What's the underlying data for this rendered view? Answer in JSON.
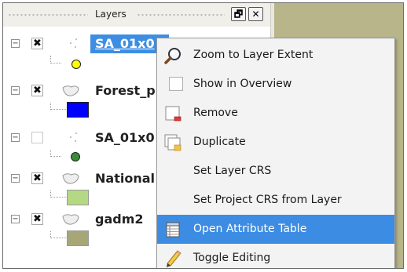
{
  "panel": {
    "title": "Layers",
    "float_button_glyph": "🗗",
    "close_button_glyph": "✕"
  },
  "layers": [
    {
      "name": "SA_01x0",
      "checked": true,
      "geometry": "point",
      "legend": "yellow-circle",
      "legend_color": "#ffff00",
      "selected": true
    },
    {
      "name": "Forest_p",
      "checked": true,
      "geometry": "polygon",
      "legend": "blue-square",
      "legend_color": "#0000ff"
    },
    {
      "name": "SA_01x0",
      "checked": false,
      "geometry": "point",
      "legend": "green-circle",
      "legend_color": "#3a8c3a"
    },
    {
      "name": "National",
      "checked": true,
      "geometry": "polygon",
      "legend": "lightgreen-square",
      "legend_color": "#b5d884"
    },
    {
      "name": "gadm2",
      "checked": true,
      "geometry": "polygon",
      "legend": "khaki-square",
      "legend_color": "#a7a677"
    }
  ],
  "glyphs": {
    "expander": "−",
    "check": "✖"
  },
  "context_menu": {
    "items": [
      {
        "label": "Zoom to Layer Extent",
        "icon": "magnifier-icon"
      },
      {
        "label": "Show in Overview",
        "icon": "checkbox-icon"
      },
      {
        "label": "Remove",
        "icon": "remove-layer-icon"
      },
      {
        "label": "Duplicate",
        "icon": "duplicate-layer-icon"
      },
      {
        "label": "Set Layer CRS",
        "icon": ""
      },
      {
        "label": "Set Project CRS from Layer",
        "icon": ""
      },
      {
        "label": "Open Attribute Table",
        "icon": "table-icon",
        "highlighted": true
      },
      {
        "label": "Toggle Editing",
        "icon": "pencil-icon"
      }
    ]
  },
  "colors": {
    "selection": "#3d8ee3",
    "menu_highlight": "#3c8ce4",
    "map_background": "#b8b58a"
  }
}
